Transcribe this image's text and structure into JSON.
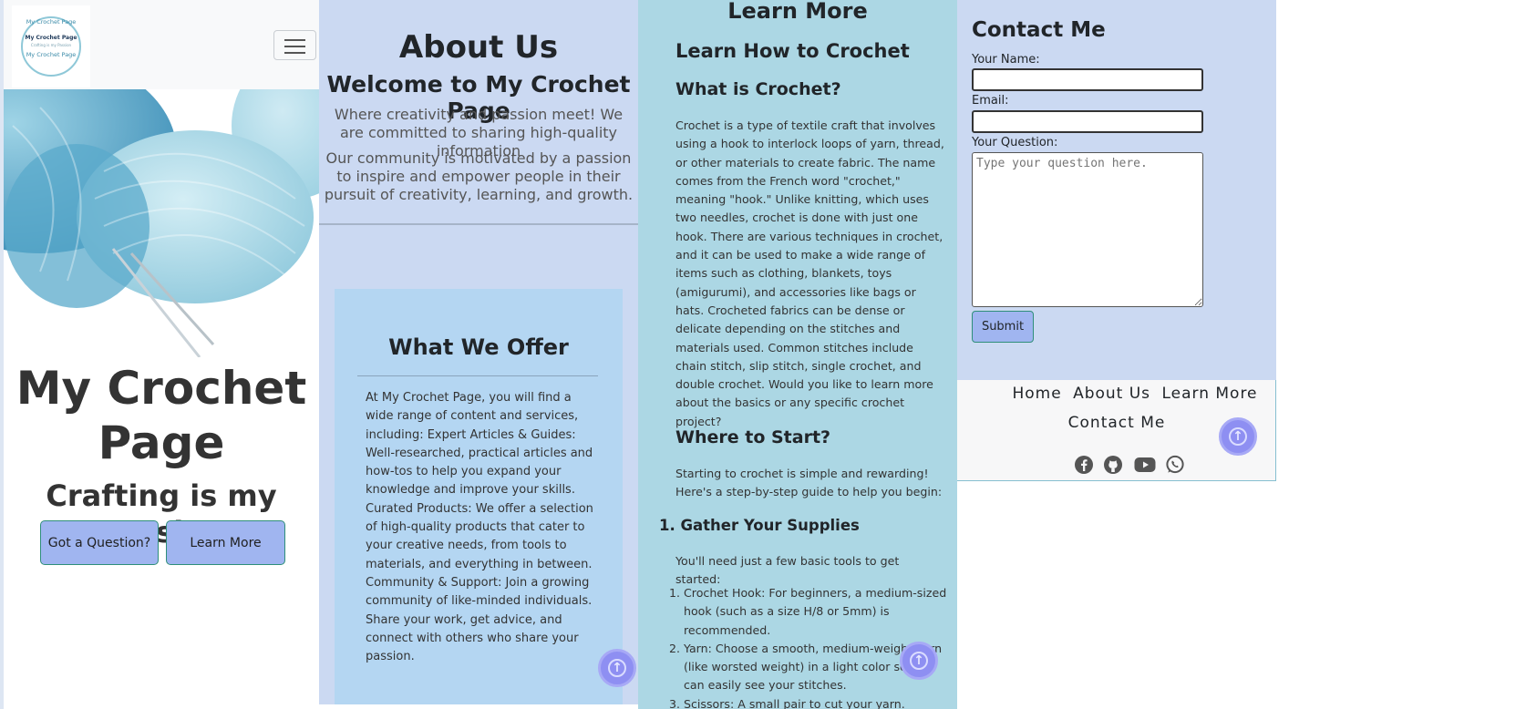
{
  "home": {
    "logo": {
      "ring_top": "My Crochet Page",
      "center": "My Crochet Page",
      "tagline": "Crafting is my Passion",
      "ring_bottom": "My Crochet Page"
    },
    "hero_title": "My Crochet Page",
    "hero_subtitle": "Crafting is my Passion",
    "buttons": {
      "question": "Got a Question?",
      "learn_more": "Learn More"
    },
    "menu_icon": "hamburger-menu-icon"
  },
  "about": {
    "title": "About Us",
    "welcome": "Welcome to My Crochet Page",
    "p1": "Where creativity and passion meet! We are committed to sharing high-quality information",
    "p2": "Our community is motivated by a passion to inspire and empower people in their pursuit of creativity, learning, and growth.",
    "offer": {
      "title": "What We Offer",
      "text": "At My Crochet Page, you will find a wide range of content and services, including: Expert Articles & Guides: Well-researched, practical articles and how-tos to help you expand your knowledge and improve your skills. Curated Products: We offer a selection of high-quality products that cater to your creative needs, from tools to materials, and everything in between. Community & Support: Join a growing community of like-minded individuals. Share your work, get advice, and connect with others who share your passion."
    }
  },
  "learn": {
    "title": "Learn More",
    "h2": "Learn How to Crochet",
    "h3_what": "What is Crochet?",
    "p_what": "Crochet is a type of textile craft that involves using a hook to interlock loops of yarn, thread, or other materials to create fabric. The name comes from the French word \"crochet,\" meaning \"hook.\" Unlike knitting, which uses two needles, crochet is done with just one hook. There are various techniques in crochet, and it can be used to make a wide range of items such as clothing, blankets, toys (amigurumi), and accessories like bags or hats. Crocheted fabrics can be dense or delicate depending on the stitches and materials used. Common stitches include chain stitch, slip stitch, single crochet, and double crochet. Would you like to learn more about the basics or any specific crochet project?",
    "h3_start": "Where to Start?",
    "p_start": "Starting to crochet is simple and rewarding! Here's a step-by-step guide to help you begin:",
    "h4_supplies": "1. Gather Your Supplies",
    "p_supplies": "You'll need just a few basic tools to get started:",
    "supplies": [
      "Crochet Hook: For beginners, a medium-sized hook (such as a size H/8 or 5mm) is recommended.",
      "Yarn: Choose a smooth, medium-weight yarn (like worsted weight) in a light color so you can easily see your stitches.",
      "Scissors: A small pair to cut your yarn."
    ]
  },
  "contact": {
    "title": "Contact Me",
    "name_label": "Your Name:",
    "email_label": "Email:",
    "question_label": "Your Question:",
    "question_placeholder": "Type your question here.",
    "submit": "Submit"
  },
  "footer": {
    "nav": [
      "Home",
      "About Us",
      "Learn More",
      "Contact Me"
    ],
    "social_icons": [
      "facebook-icon",
      "github-icon",
      "youtube-icon",
      "whatsapp-icon"
    ]
  },
  "colors": {
    "about_bg": "#cbd9f2",
    "learn_bg": "#acd7e4",
    "offer_card_bg": "#b4d6f2",
    "button_bg": "#a0b5f0",
    "scroll_button": "#8e8ff2"
  }
}
